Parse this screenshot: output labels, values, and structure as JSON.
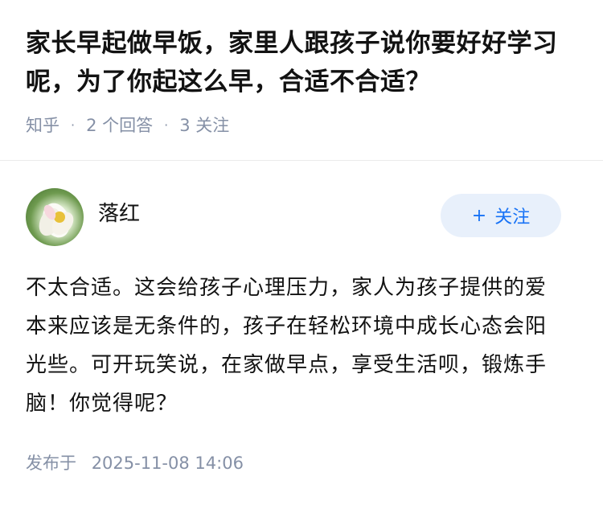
{
  "question": {
    "title": "家长早起做早饭，家里人跟孩子说你要好好学习呢，为了你起这么早，合适不合适？",
    "source": "知乎",
    "answers_count": "2 个回答",
    "followers_count": "3 关注"
  },
  "answer": {
    "author_name": "落红",
    "follow_label": "关注",
    "follow_icon": "plus-icon",
    "avatar_icon": "lotus-flower-avatar",
    "content": "不太合适。这会给孩子心理压力，家人为孩子提供的爱本来应该是无条件的，孩子在轻松环境中成长心态会阳光些。可开玩笑说，在家做早点，享受生活呗，锻炼手脑！你觉得呢？",
    "published_label": "发布于",
    "published_time": "2025-11-08 14:06"
  },
  "colors": {
    "title": "#121212",
    "meta": "#8590a6",
    "accent": "#1772f6",
    "follow_bg": "#e8f0fb"
  }
}
